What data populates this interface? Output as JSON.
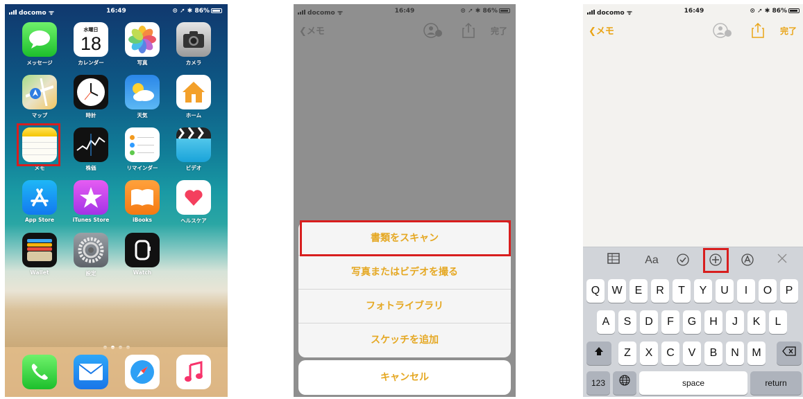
{
  "status": {
    "carrier": "docomo",
    "time": "16:49",
    "battery": "86%"
  },
  "home": {
    "rows": [
      [
        {
          "label": "メッセージ",
          "icon": "messages-icon"
        },
        {
          "label": "カレンダー",
          "icon": "calendar-icon",
          "weekday": "水曜日",
          "date": "18"
        },
        {
          "label": "写真",
          "icon": "photos-icon"
        },
        {
          "label": "カメラ",
          "icon": "camera-icon"
        }
      ],
      [
        {
          "label": "マップ",
          "icon": "maps-icon"
        },
        {
          "label": "時計",
          "icon": "clock-icon"
        },
        {
          "label": "天気",
          "icon": "weather-icon"
        },
        {
          "label": "ホーム",
          "icon": "home-icon"
        }
      ],
      [
        {
          "label": "メモ",
          "icon": "notes-icon"
        },
        {
          "label": "株価",
          "icon": "stocks-icon"
        },
        {
          "label": "リマインダー",
          "icon": "reminders-icon"
        },
        {
          "label": "ビデオ",
          "icon": "videos-icon"
        }
      ],
      [
        {
          "label": "App Store",
          "icon": "app-store-icon"
        },
        {
          "label": "iTunes Store",
          "icon": "itunes-store-icon"
        },
        {
          "label": "iBooks",
          "icon": "ibooks-icon"
        },
        {
          "label": "ヘルスケア",
          "icon": "health-icon"
        }
      ],
      [
        {
          "label": "Wallet",
          "icon": "wallet-icon"
        },
        {
          "label": "設定",
          "icon": "settings-icon"
        },
        {
          "label": "Watch",
          "icon": "watch-icon"
        }
      ]
    ],
    "dock": [
      {
        "icon": "phone-icon"
      },
      {
        "icon": "mail-icon"
      },
      {
        "icon": "safari-icon"
      },
      {
        "icon": "music-icon"
      }
    ],
    "highlighted_app": "メモ"
  },
  "nav": {
    "back_label": "メモ",
    "done_label": "完了"
  },
  "action_sheet": {
    "items": [
      "書類をスキャン",
      "写真またはビデオを撮る",
      "フォトライブラリ",
      "スケッチを追加"
    ],
    "cancel_label": "キャンセル",
    "highlighted_item": "書類をスキャン"
  },
  "toolbar": {
    "tools": [
      {
        "name": "table-icon",
        "glyph": "▦"
      },
      {
        "name": "format-icon",
        "glyph": "Aa"
      },
      {
        "name": "checklist-icon",
        "glyph": "✓"
      },
      {
        "name": "add-icon",
        "glyph": "+"
      },
      {
        "name": "markup-icon",
        "glyph": "A"
      },
      {
        "name": "close-icon",
        "glyph": "✕"
      }
    ],
    "highlighted_tool": "add-icon"
  },
  "keyboard": {
    "row1": [
      "Q",
      "W",
      "E",
      "R",
      "T",
      "Y",
      "U",
      "I",
      "O",
      "P"
    ],
    "row2": [
      "A",
      "S",
      "D",
      "F",
      "G",
      "H",
      "J",
      "K",
      "L"
    ],
    "row3": [
      "Z",
      "X",
      "C",
      "V",
      "B",
      "N",
      "M"
    ],
    "numbers_key": "123",
    "space_key": "space",
    "return_key": "return"
  },
  "colors": {
    "accent": "#e5a823",
    "highlight": "#d81e1e"
  }
}
